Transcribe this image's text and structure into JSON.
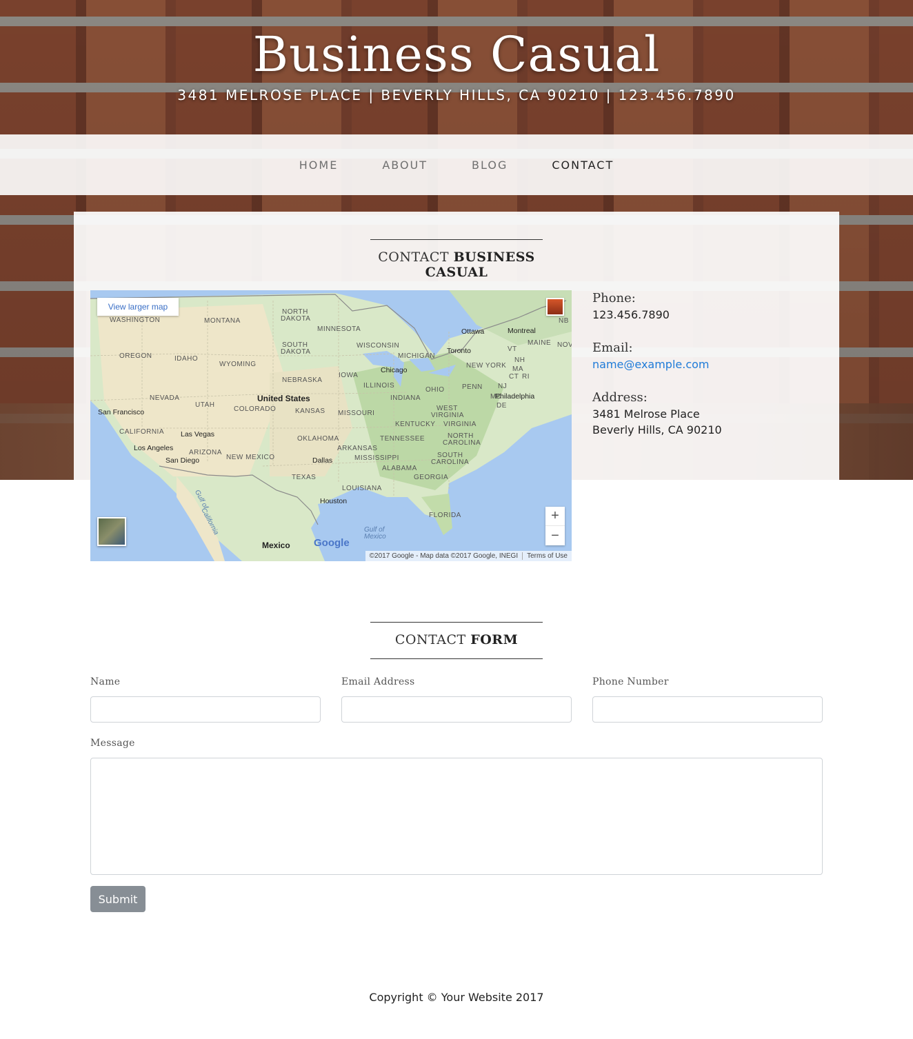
{
  "site": {
    "brand": "Business Casual",
    "address_bar": "3481 MELROSE PLACE | BEVERLY HILLS, CA 90210 | 123.456.7890"
  },
  "nav": {
    "items": [
      {
        "label": "HOME"
      },
      {
        "label": "ABOUT"
      },
      {
        "label": "BLOG"
      },
      {
        "label": "CONTACT",
        "active": true
      }
    ]
  },
  "contact_section": {
    "title_light": "CONTACT ",
    "title_strong": "BUSINESS CASUAL",
    "phone_label": "Phone:",
    "phone": "123.456.7890",
    "email_label": "Email:",
    "email": "name@example.com",
    "address_label": "Address:",
    "address_line1": "3481 Melrose Place",
    "address_line2": "Beverly Hills, CA 90210"
  },
  "map": {
    "view_larger": "View larger map",
    "zoom_in": "+",
    "zoom_out": "−",
    "logo": "Google",
    "attribution": "©2017 Google - Map data ©2017 Google, INEGI",
    "terms": "Terms of Use",
    "labels": {
      "washington": "WASHINGTON",
      "montana": "MONTANA",
      "north_dakota_1": "NORTH",
      "north_dakota_2": "DAKOTA",
      "minnesota": "MINNESOTA",
      "ottawa": "Ottawa",
      "montreal": "Montreal",
      "nb": "NB",
      "maine": "MAINE",
      "nov": "NOV",
      "oregon": "OREGON",
      "idaho": "IDAHO",
      "wyoming": "WYOMING",
      "south_dakota_1": "SOUTH",
      "south_dakota_2": "DAKOTA",
      "wisconsin": "WISCONSIN",
      "michigan": "MICHIGAN",
      "toronto": "Toronto",
      "vt": "VT",
      "nh": "NH",
      "ma": "MA",
      "new_york": "NEW YORK",
      "ct": "CT",
      "ri": "RI",
      "iowa": "IOWA",
      "chicago": "Chicago",
      "nebraska": "NEBRASKA",
      "nevada": "NEVADA",
      "utah": "UTAH",
      "united_states": "United States",
      "illinois": "ILLINOIS",
      "indiana": "INDIANA",
      "ohio": "OHIO",
      "penn": "PENN",
      "nj": "NJ",
      "philadelphia": "Philadelphia",
      "md": "MD",
      "de": "DE",
      "san_francisco": "San Francisco",
      "colorado": "COLORADO",
      "kansas": "KANSAS",
      "missouri": "MISSOURI",
      "west_virginia_1": "WEST",
      "west_virginia_2": "VIRGINIA",
      "kentucky": "KENTUCKY",
      "virginia": "VIRGINIA",
      "california": "CALIFORNIA",
      "las_vegas": "Las Vegas",
      "oklahoma": "OKLAHOMA",
      "tennessee": "TENNESSEE",
      "north_carolina_1": "NORTH",
      "north_carolina_2": "CAROLINA",
      "los_angeles": "Los Angeles",
      "arizona": "ARIZONA",
      "arkansas": "ARKANSAS",
      "san_diego": "San Diego",
      "new_mexico": "NEW MEXICO",
      "dallas": "Dallas",
      "mississippi": "MISSISSIPPI",
      "south_carolina_1": "SOUTH",
      "south_carolina_2": "CAROLINA",
      "alabama": "ALABAMA",
      "georgia": "GEORGIA",
      "texas": "TEXAS",
      "louisiana": "LOUISIANA",
      "houston": "Houston",
      "gulf_california_1": "Gulf of",
      "gulf_california_2": "California",
      "florida": "FLORIDA",
      "gulf_mexico_1": "Gulf of",
      "gulf_mexico_2": "Mexico",
      "mexico": "Mexico"
    },
    "colors": {
      "water": "#a8c9f0",
      "land": "#d9e8c8",
      "desert": "#eee6c9",
      "forest": "#b8d6a0",
      "border": "#8a8a8a"
    }
  },
  "form_section": {
    "title_light": "CONTACT ",
    "title_strong": "FORM",
    "name_label": "Name",
    "email_label": "Email Address",
    "phone_label": "Phone Number",
    "message_label": "Message",
    "name_value": "",
    "email_value": "",
    "phone_value": "",
    "message_value": "",
    "submit": "Submit"
  },
  "footer": {
    "copyright": "Copyright © Your Website 2017"
  }
}
